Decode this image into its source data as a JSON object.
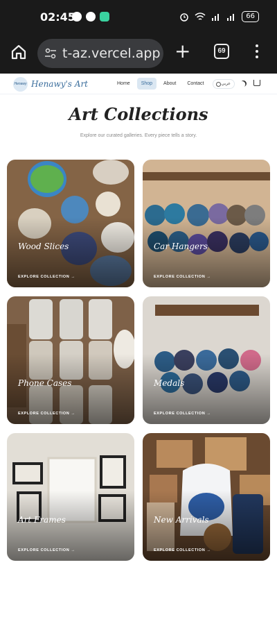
{
  "status_bar": {
    "time": "02:45",
    "battery": "66"
  },
  "browser": {
    "url": "t-az.vercel.app",
    "tab_count": "69"
  },
  "site": {
    "logo_badge": "Henawy",
    "logo_text": "Henawy's Art",
    "nav": [
      {
        "label": "Home"
      },
      {
        "label": "Shop"
      },
      {
        "label": "About"
      },
      {
        "label": "Contact"
      }
    ],
    "lang_label": "عربي"
  },
  "page": {
    "title": "Art Collections",
    "subtitle": "Explore our curated galleries. Every piece tells a story."
  },
  "collections": [
    {
      "title": "Wood Slices",
      "cta": "EXPLORE COLLECTION →",
      "bg": "#8a6a4a"
    },
    {
      "title": "Car Hangers",
      "cta": "EXPLORE COLLECTION →",
      "bg": "#c9a885"
    },
    {
      "title": "Phone Cases",
      "cta": "EXPLORE COLLECTION →",
      "bg": "#8c6f55"
    },
    {
      "title": "Medals",
      "cta": "EXPLORE COLLECTION →",
      "bg": "#d8d2cb"
    },
    {
      "title": "Art Frames",
      "cta": "EXPLORE COLLECTION →",
      "bg": "#dedad2"
    },
    {
      "title": "New Arrivals",
      "cta": "EXPLORE COLLECTION →",
      "bg": "#7a5a3d"
    }
  ]
}
